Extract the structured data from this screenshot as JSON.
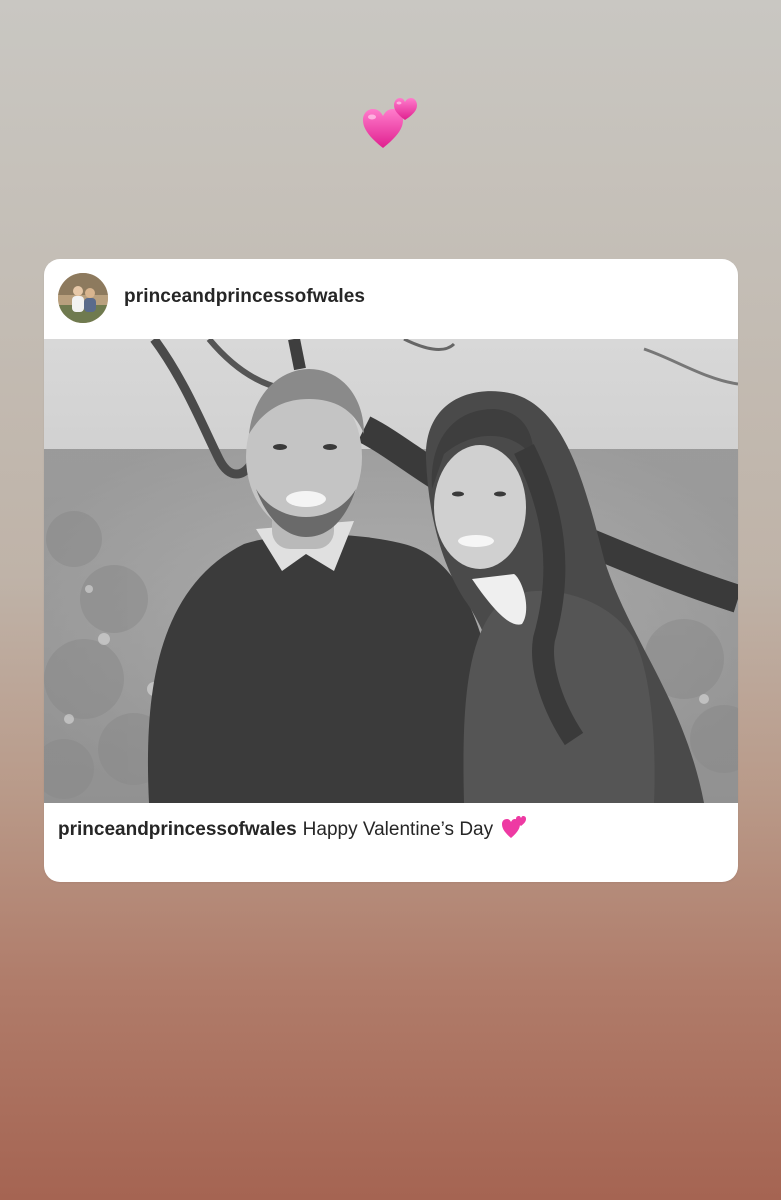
{
  "story": {
    "sticker_icon": "two-hearts-icon"
  },
  "post": {
    "username": "princeandprincessofwales",
    "avatar_icon": "profile-photo-avatar",
    "photo_alt": "photo",
    "caption_username": "princeandprincessofwales",
    "caption_text": "Happy Valentine’s Day",
    "caption_icon": "two-hearts-icon"
  },
  "colors": {
    "heart_pink": "#f23aa8",
    "text": "#262626",
    "card_bg": "#ffffff"
  }
}
